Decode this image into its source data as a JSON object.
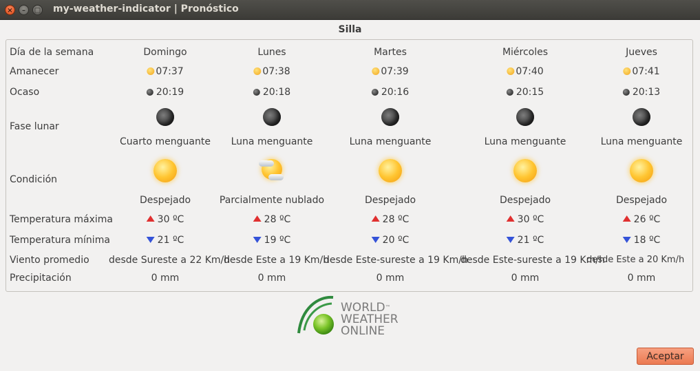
{
  "window": {
    "title": "my-weather-indicator | Pronóstico"
  },
  "location": "Silla",
  "rows": {
    "day": "Día de la semana",
    "sunrise": "Amanecer",
    "sunset": "Ocaso",
    "moon": "Fase lunar",
    "condition": "Condición",
    "tmax": "Temperatura máxima",
    "tmin": "Temperatura mínima",
    "wind": "Viento promedio",
    "precip": "Precipitación"
  },
  "days": [
    {
      "day": "Domingo",
      "sunrise": "07:37",
      "sunset": "20:19",
      "moon": "Cuarto menguante",
      "condition": "Despejado",
      "condition_icon": "sun-icon",
      "tmax": "30 ºC",
      "tmin": "21 ºC",
      "wind": "desde Sureste a 22 Km/h",
      "precip": "0 mm"
    },
    {
      "day": "Lunes",
      "sunrise": "07:38",
      "sunset": "20:18",
      "moon": "Luna menguante",
      "condition": "Parcialmente nublado",
      "condition_icon": "partly-cloudy-icon",
      "tmax": "28 ºC",
      "tmin": "19 ºC",
      "wind": "desde Este a 19 Km/h",
      "precip": "0 mm"
    },
    {
      "day": "Martes",
      "sunrise": "07:39",
      "sunset": "20:16",
      "moon": "Luna menguante",
      "condition": "Despejado",
      "condition_icon": "sun-icon",
      "tmax": "28 ºC",
      "tmin": "20 ºC",
      "wind": "desde Este-sureste a 19 Km/h",
      "precip": "0 mm"
    },
    {
      "day": "Miércoles",
      "sunrise": "07:40",
      "sunset": "20:15",
      "moon": "Luna menguante",
      "condition": "Despejado",
      "condition_icon": "sun-icon",
      "tmax": "30 ºC",
      "tmin": "21 ºC",
      "wind": "desde Este-sureste a 19 Km/h",
      "precip": "0 mm"
    },
    {
      "day": "Jueves",
      "sunrise": "07:41",
      "sunset": "20:13",
      "moon": "Luna menguante",
      "condition": "Despejado",
      "condition_icon": "sun-icon",
      "tmax": "26 ºC",
      "tmin": "18 ºC",
      "wind": "desde Este a 20 Km/h",
      "precip": "0 mm"
    }
  ],
  "logo": {
    "line1": "WORLD",
    "line2": "WEATHER",
    "line3": "ONLINE",
    "tm": "™"
  },
  "buttons": {
    "accept": "Aceptar"
  },
  "colors": {
    "accent": "#eb7a52",
    "temp_up": "#e03030",
    "temp_down": "#3553d8"
  }
}
